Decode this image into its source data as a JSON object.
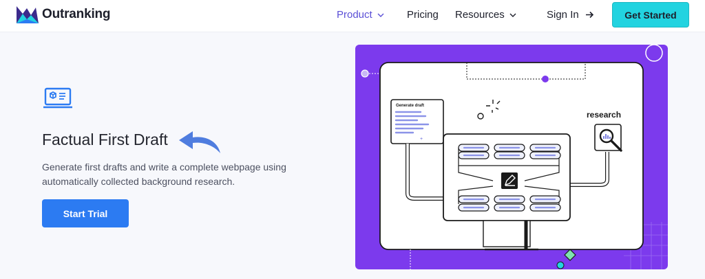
{
  "brand": {
    "name": "Outranking"
  },
  "nav": {
    "items": [
      {
        "label": "Product",
        "has_dropdown": true,
        "active": true
      },
      {
        "label": "Pricing",
        "has_dropdown": false
      },
      {
        "label": "Resources",
        "has_dropdown": true
      },
      {
        "label": "Sign In",
        "has_arrow": true
      }
    ],
    "cta_label": "Get Started"
  },
  "hero": {
    "title": "Factual First Draft",
    "description": "Generate first drafts and write a complete webpage using automatically collected background research.",
    "button_label": "Start Trial"
  },
  "illustration": {
    "card_label": "Generate draft",
    "card_plus": "+",
    "research_label": "research"
  },
  "colors": {
    "accent_purple": "#7c3aed",
    "nav_active": "#5a4fd6",
    "cta_cyan": "#22d3e0",
    "primary_blue": "#2c7bf2",
    "arrow_blue": "#4f7ddf"
  },
  "icons": [
    "brand-logo-icon",
    "chevron-down-icon",
    "arrow-right-icon",
    "laptop-cube-icon",
    "curved-arrow-icon",
    "magnifier-chart-icon",
    "edit-icon"
  ]
}
